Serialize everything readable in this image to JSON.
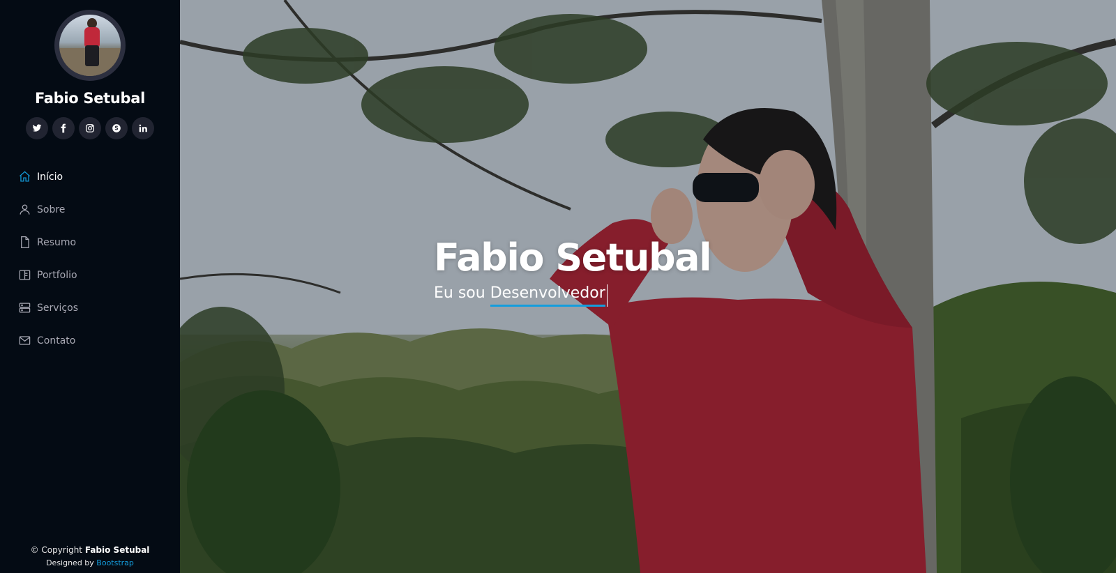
{
  "profile": {
    "name": "Fabio Setubal"
  },
  "social": [
    {
      "icon": "twitter-icon",
      "label": "twitter"
    },
    {
      "icon": "facebook-icon",
      "label": "facebook"
    },
    {
      "icon": "instagram-icon",
      "label": "instagram"
    },
    {
      "icon": "skype-icon",
      "label": "skype"
    },
    {
      "icon": "linkedin-icon",
      "label": "linkedin"
    }
  ],
  "nav": [
    {
      "label": "Início",
      "icon": "house-icon",
      "active": true
    },
    {
      "label": "Sobre",
      "icon": "person-icon",
      "active": false
    },
    {
      "label": "Resumo",
      "icon": "file-icon",
      "active": false
    },
    {
      "label": "Portfolio",
      "icon": "layout-icon",
      "active": false
    },
    {
      "label": "Serviços",
      "icon": "server-icon",
      "active": false
    },
    {
      "label": "Contato",
      "icon": "envelope-icon",
      "active": false
    }
  ],
  "footer": {
    "copyright_prefix": "© Copyright",
    "copyright_name": "Fabio Setubal",
    "designed_by": "Designed by",
    "designer": "Bootstrap"
  },
  "hero": {
    "title": "Fabio Setubal",
    "subtitle_prefix": "Eu sou",
    "subtitle_word": "Desenvolvedor"
  },
  "colors": {
    "accent": "#149ddd",
    "sidebar_bg": "#040b14",
    "social_bg": "#212431",
    "nav_text": "#a8a9b4"
  }
}
